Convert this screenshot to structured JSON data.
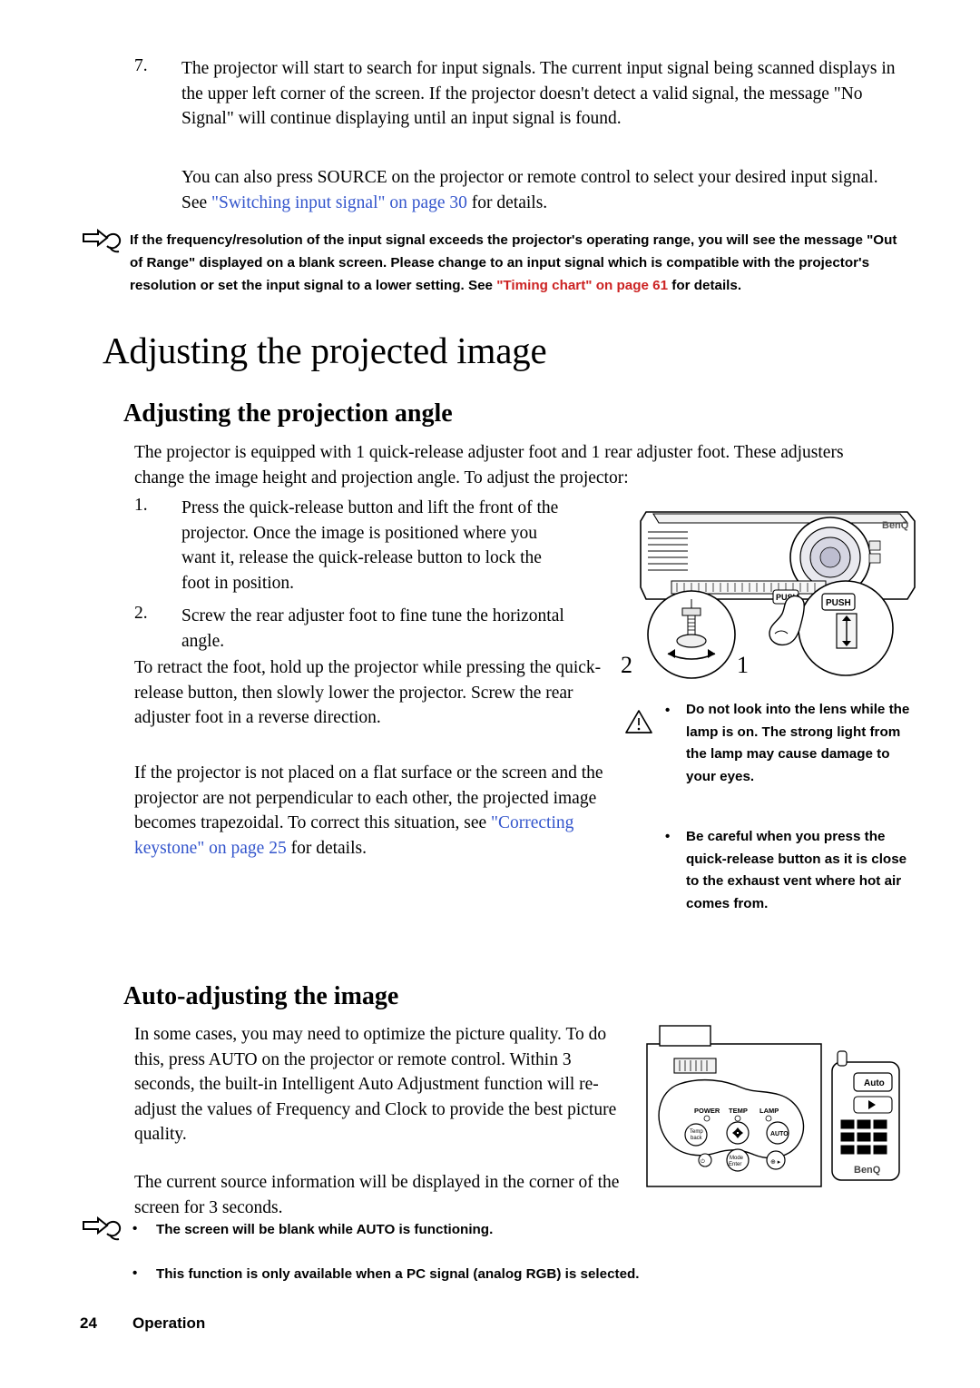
{
  "page": {
    "footer_number": "24",
    "footer_label": "Operation"
  },
  "step7": {
    "number": "7.",
    "text": "The projector will start to search for input signals. The current input signal being scanned displays in the upper left corner of the screen. If the projector doesn't detect a valid signal, the message \"No Signal\" will continue displaying until an input signal is found.",
    "text2_pre": "You can also press SOURCE on the projector or remote control to select your desired input signal. See ",
    "text2_link": "\"Switching input signal\" on page 30",
    "text2_post": " for details."
  },
  "note1": {
    "icon": "pointing-hand-icon",
    "pre": "If the frequency/resolution of the input signal exceeds the projector's operating range, you will see the message \"Out of Range\" displayed on a blank screen. Please change to an input signal which is compatible with the projector's resolution or set the input signal to a lower setting. See ",
    "link": "\"Timing chart\" on page 61",
    "post": " for details."
  },
  "headings": {
    "h1": "Adjusting the projected image",
    "h2_angle": "Adjusting the projection angle",
    "h2_auto": "Auto-adjusting the image"
  },
  "intro": {
    "text": "The projector is equipped with 1 quick-release adjuster foot and 1 rear adjuster foot. These adjusters change the image height and projection angle. To adjust the projector:"
  },
  "steps": [
    {
      "number": "1.",
      "text": "Press the quick-release button and lift the front of the projector. Once the image is positioned where you want it, release the quick-release button to lock the foot in position."
    },
    {
      "number": "2.",
      "text": "Screw the rear adjuster foot to fine tune the horizontal angle."
    }
  ],
  "body": {
    "retract": "To retract the foot, hold up the projector while pressing the quick-release button, then slowly lower the projector. Screw the rear adjuster foot in a reverse direction.",
    "trapezoid_pre": "If the projector is not placed on a flat surface or the screen and the projector are not perpendicular to each other, the projected image becomes trapezoidal. To correct this situation, see ",
    "trapezoid_link": "\"Correcting keystone\" on page 25",
    "trapezoid_post": " for details."
  },
  "projector_figure": {
    "callout_2": "2",
    "callout_1": "1",
    "push_label_1": "PUSH",
    "push_label_2": "PUSH",
    "brand": "BenQ"
  },
  "caution": {
    "icon": "warning-triangle-icon",
    "items": [
      "Do not look into the lens while the lamp is on. The strong light from the lamp may cause damage to your eyes.",
      "Be careful when you press the quick-release button as it is close to the exhaust vent where hot air comes from."
    ]
  },
  "auto_section": {
    "para1": "In some cases, you may need to optimize the picture quality. To do this, press AUTO on the projector or remote control. Within 3 seconds, the built-in Intelligent Auto Adjustment function will re-adjust the values of Frequency and Clock to provide the best picture quality.",
    "para2": "The current source information will be displayed in the corner of the screen for 3 seconds."
  },
  "panel_figure": {
    "labels": [
      "POWER",
      "TEMP",
      "LAMP"
    ],
    "buttons": [
      "Temp",
      "Auto",
      "Mode",
      "Enter"
    ],
    "remote_button": "Auto",
    "brand": "BenQ"
  },
  "note2": {
    "icon": "pointing-hand-icon",
    "items": [
      "The screen will be blank while AUTO is functioning.",
      "This function is only available when a PC signal (analog RGB) is selected."
    ]
  }
}
